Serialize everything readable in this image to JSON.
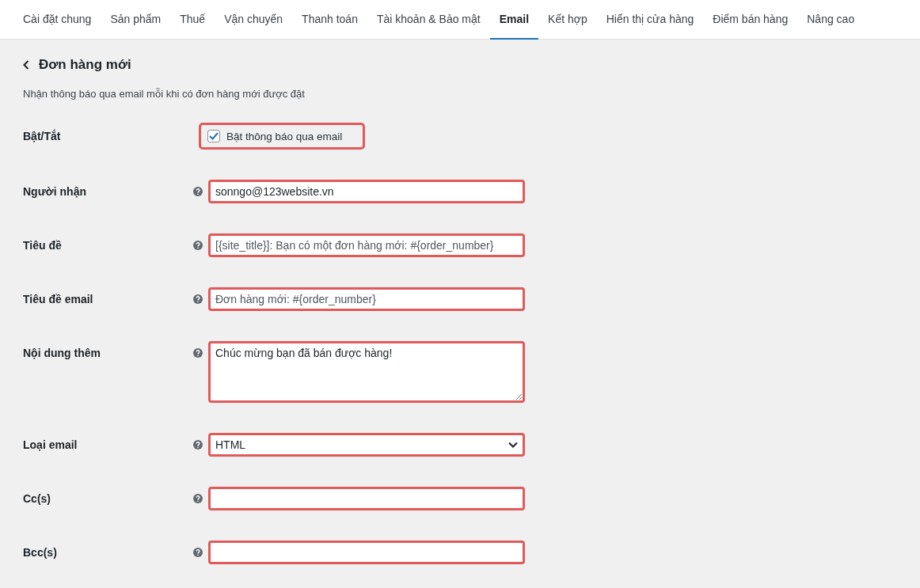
{
  "tabs": [
    {
      "label": "Cài đặt chung",
      "selected": false
    },
    {
      "label": "Sản phẩm",
      "selected": false
    },
    {
      "label": "Thuế",
      "selected": false
    },
    {
      "label": "Vận chuyển",
      "selected": false
    },
    {
      "label": "Thanh toán",
      "selected": false
    },
    {
      "label": "Tài khoản & Bảo mật",
      "selected": false
    },
    {
      "label": "Email",
      "selected": true
    },
    {
      "label": "Kết hợp",
      "selected": false
    },
    {
      "label": "Hiển thị cửa hàng",
      "selected": false
    },
    {
      "label": "Điểm bán hàng",
      "selected": false
    },
    {
      "label": "Nâng cao",
      "selected": false
    }
  ],
  "page_title": "Đơn hàng mới",
  "description": "Nhận thông báo qua email mỗi khi có đơn hàng mới được đặt",
  "fields": [
    {
      "kind": "checkbox",
      "label": "Bật/Tắt",
      "option": "Bật thông báo qua email",
      "checked": true,
      "help": false
    },
    {
      "kind": "text",
      "label": "Người nhận",
      "value": "sonngo@123website.vn",
      "help": true
    },
    {
      "kind": "text",
      "label": "Tiêu đề",
      "placeholder": "[{site_title}]: Bạn có một đơn hàng mới: #{order_number}",
      "help": true
    },
    {
      "kind": "text",
      "label": "Tiêu đề email",
      "placeholder": "Đơn hàng mới: #{order_number}",
      "help": true
    },
    {
      "kind": "textarea",
      "label": "Nội dung thêm",
      "value": "Chúc mừng bạn đã bán được hàng!",
      "help": true
    },
    {
      "kind": "select",
      "label": "Loại email",
      "value": "HTML",
      "help": true
    },
    {
      "kind": "text",
      "label": "Cc(s)",
      "help": true
    },
    {
      "kind": "text",
      "label": "Bcc(s)",
      "help": true
    }
  ]
}
